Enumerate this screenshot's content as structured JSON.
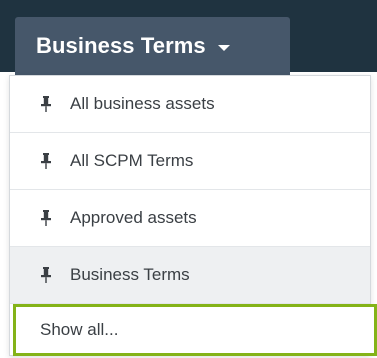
{
  "view_selector": {
    "label": "Business Terms"
  },
  "menu": {
    "items": [
      {
        "label": "All business assets",
        "icon": "pin-icon"
      },
      {
        "label": "All SCPM Terms",
        "icon": "pin-icon"
      },
      {
        "label": "Approved assets",
        "icon": "pin-icon"
      },
      {
        "label": "Business Terms",
        "icon": "pin-icon",
        "selected": true
      }
    ],
    "show_all_label": "Show all..."
  },
  "colors": {
    "topbar": "#1f3340",
    "button": "#46576a",
    "highlight_border": "#84b318",
    "selected_row": "#eef0f2"
  }
}
